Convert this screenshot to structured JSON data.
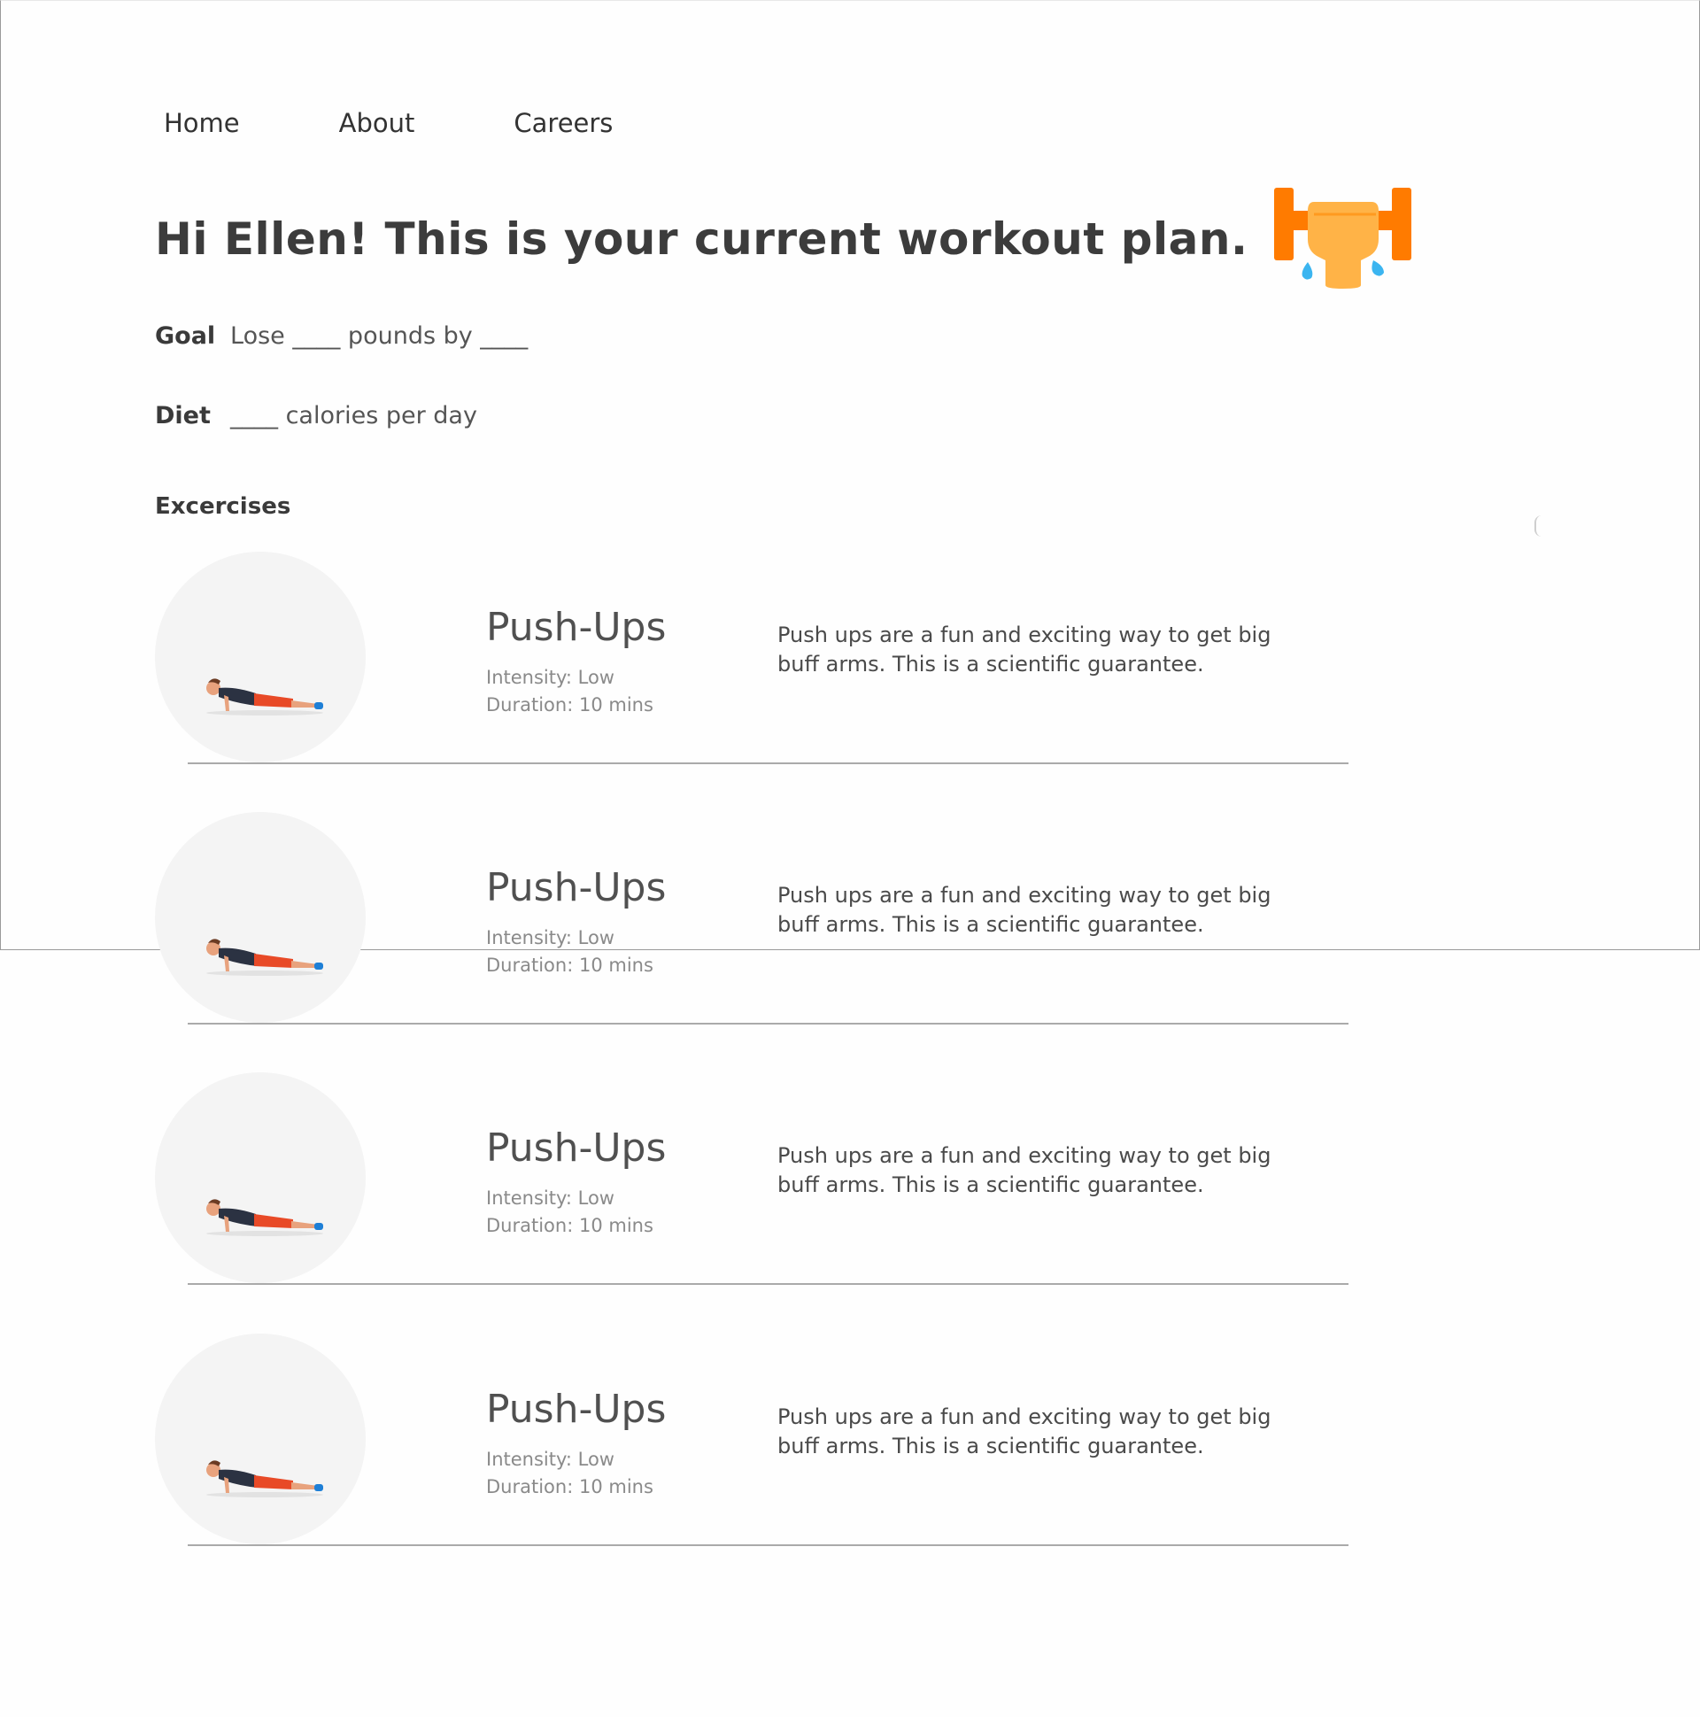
{
  "nav": {
    "items": [
      {
        "label": "Home"
      },
      {
        "label": "About"
      },
      {
        "label": "Careers"
      }
    ]
  },
  "header": {
    "title": "Hi Ellen! This is your current workout plan.",
    "icon": "dumbbell-lift-icon"
  },
  "plan": {
    "goal_label": "Goal",
    "goal_value": "Lose ____ pounds by ____",
    "diet_label": "Diet",
    "diet_value": "____ calories per day"
  },
  "exercises_section": {
    "title": "Excercises",
    "items": [
      {
        "name": "Push-Ups",
        "intensity": "Intensity: Low",
        "duration": "Duration: 10 mins",
        "description": "Push ups are a fun and exciting way to get big buff arms. This is a scientific guarantee.",
        "image_icon": "push-up-figure-icon"
      },
      {
        "name": "Push-Ups",
        "intensity": "Intensity: Low",
        "duration": "Duration: 10 mins",
        "description": "Push ups are a fun and exciting way to get big buff arms. This is a scientific guarantee.",
        "image_icon": "push-up-figure-icon"
      },
      {
        "name": "Push-Ups",
        "intensity": "Intensity: Low",
        "duration": "Duration: 10 mins",
        "description": "Push ups are a fun and exciting way to get big buff arms. This is a scientific guarantee.",
        "image_icon": "push-up-figure-icon"
      },
      {
        "name": "Push-Ups",
        "intensity": "Intensity: Low",
        "duration": "Duration: 10 mins",
        "description": "Push ups are a fun and exciting way to get big buff arms. This is a scientific guarantee.",
        "image_icon": "push-up-figure-icon"
      }
    ]
  },
  "colors": {
    "dumbbell_orange": "#ff7b00",
    "dumbbell_light": "#ffb347",
    "sweat_blue": "#3bb5f0",
    "thumb_bg": "#f4f4f4",
    "text_dark": "#3c3c3c"
  }
}
